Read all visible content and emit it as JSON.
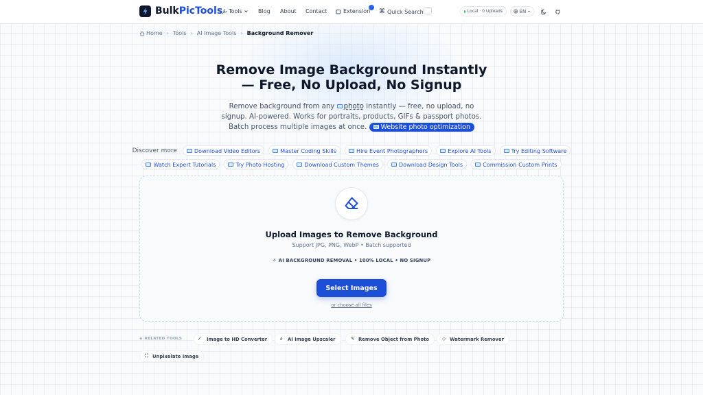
{
  "header": {
    "brand_prefix": "Bulk",
    "brand_suffix": "PicTools",
    "nav": {
      "tools": "Tools",
      "blog": "Blog",
      "about": "About",
      "contact": "Contact",
      "extension": "Extension",
      "quick_search": "Quick Search"
    },
    "status_pill": "Local · 0 Uploads",
    "language": "EN"
  },
  "breadcrumb": [
    "Home",
    "Tools",
    "AI Image Tools",
    "Background Remover"
  ],
  "hero": {
    "title_line1": "Remove Image Background Instantly",
    "title_line2": "— Free, No Upload, No Signup",
    "sub_before": "Remove background from any ",
    "sub_photo": "photo",
    "sub_after": " instantly — free, no upload, no signup. AI-powered. Works for portraits, products, GIFs & passport photos. Batch process multiple images at once. ",
    "highlight": "Website photo optimization"
  },
  "discover": {
    "label": "Discover more",
    "row1": [
      "Download Video Editors",
      "Master Coding Skills",
      "Hire Event Photographers",
      "Explore AI Tools",
      "Try Editing Software"
    ],
    "row2": [
      "Watch Expert Tutorials",
      "Try Photo Hosting",
      "Download Custom Themes",
      "Download Design Tools",
      "Commission Custom Prints"
    ]
  },
  "upload": {
    "title": "Upload Images to Remove Background",
    "subtitle": "Support JPG, PNG, WebP • Batch supported",
    "features": "AI BACKGROUND REMOVAL • 100% LOCAL • NO SIGNUP",
    "button": "Select Images",
    "choose_all": "or choose all files"
  },
  "related": {
    "label": "RELATED TOOLS",
    "items": [
      "Image to HD Converter",
      "AI Image Upscaler",
      "Remove Object from Photo",
      "Watermark Remover",
      "Unpixelate Image"
    ]
  },
  "colors": {
    "accent": "#1d4ed8",
    "status_dot": "#22c55e",
    "bg": "#f8fafc"
  },
  "icons": [
    "bolt-icon",
    "wrench-icon",
    "chevron-down-icon",
    "puzzle-icon",
    "command-icon",
    "globe-icon",
    "moon-icon",
    "github-icon",
    "home-icon",
    "eraser-icon",
    "sparkle-icon",
    "layers-icon",
    "image-icon"
  ]
}
